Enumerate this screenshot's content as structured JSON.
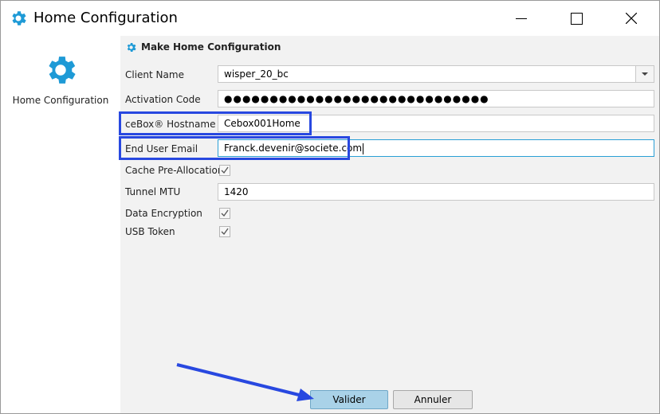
{
  "window": {
    "title": "Home Configuration",
    "icon": "gear-icon",
    "controls": [
      "minimize-icon",
      "maximize-icon",
      "close-icon"
    ]
  },
  "sidebar": {
    "items": [
      {
        "label": "Home Configuration",
        "icon": "gear-icon"
      }
    ]
  },
  "form": {
    "title": "Make Home Configuration",
    "client_name": {
      "label": "Client Name",
      "value": "wisper_20_bc"
    },
    "activation_code": {
      "label": "Activation Code",
      "value": "●●●●●●●●●●●●●●●●●●●●●●●●●●●●●"
    },
    "hostname": {
      "label": "ceBox® Hostname",
      "value": "Cebox001Home"
    },
    "email": {
      "label": "End User Email",
      "value": "Franck.devenir@societe.com"
    },
    "cache": {
      "label": "Cache Pre-Allocation",
      "checked": true
    },
    "mtu": {
      "label": "Tunnel MTU",
      "value": "1420"
    },
    "encryption": {
      "label": "Data Encryption",
      "checked": true
    },
    "usb_token": {
      "label": "USB Token",
      "checked": true
    }
  },
  "buttons": {
    "valider": "Valider",
    "annuler": "Annuler"
  },
  "colors": {
    "accent": "#1e9ad6",
    "highlight": "#2848e0",
    "primary_button": "#a9d2e8",
    "panel_bg": "#f2f2f2"
  }
}
